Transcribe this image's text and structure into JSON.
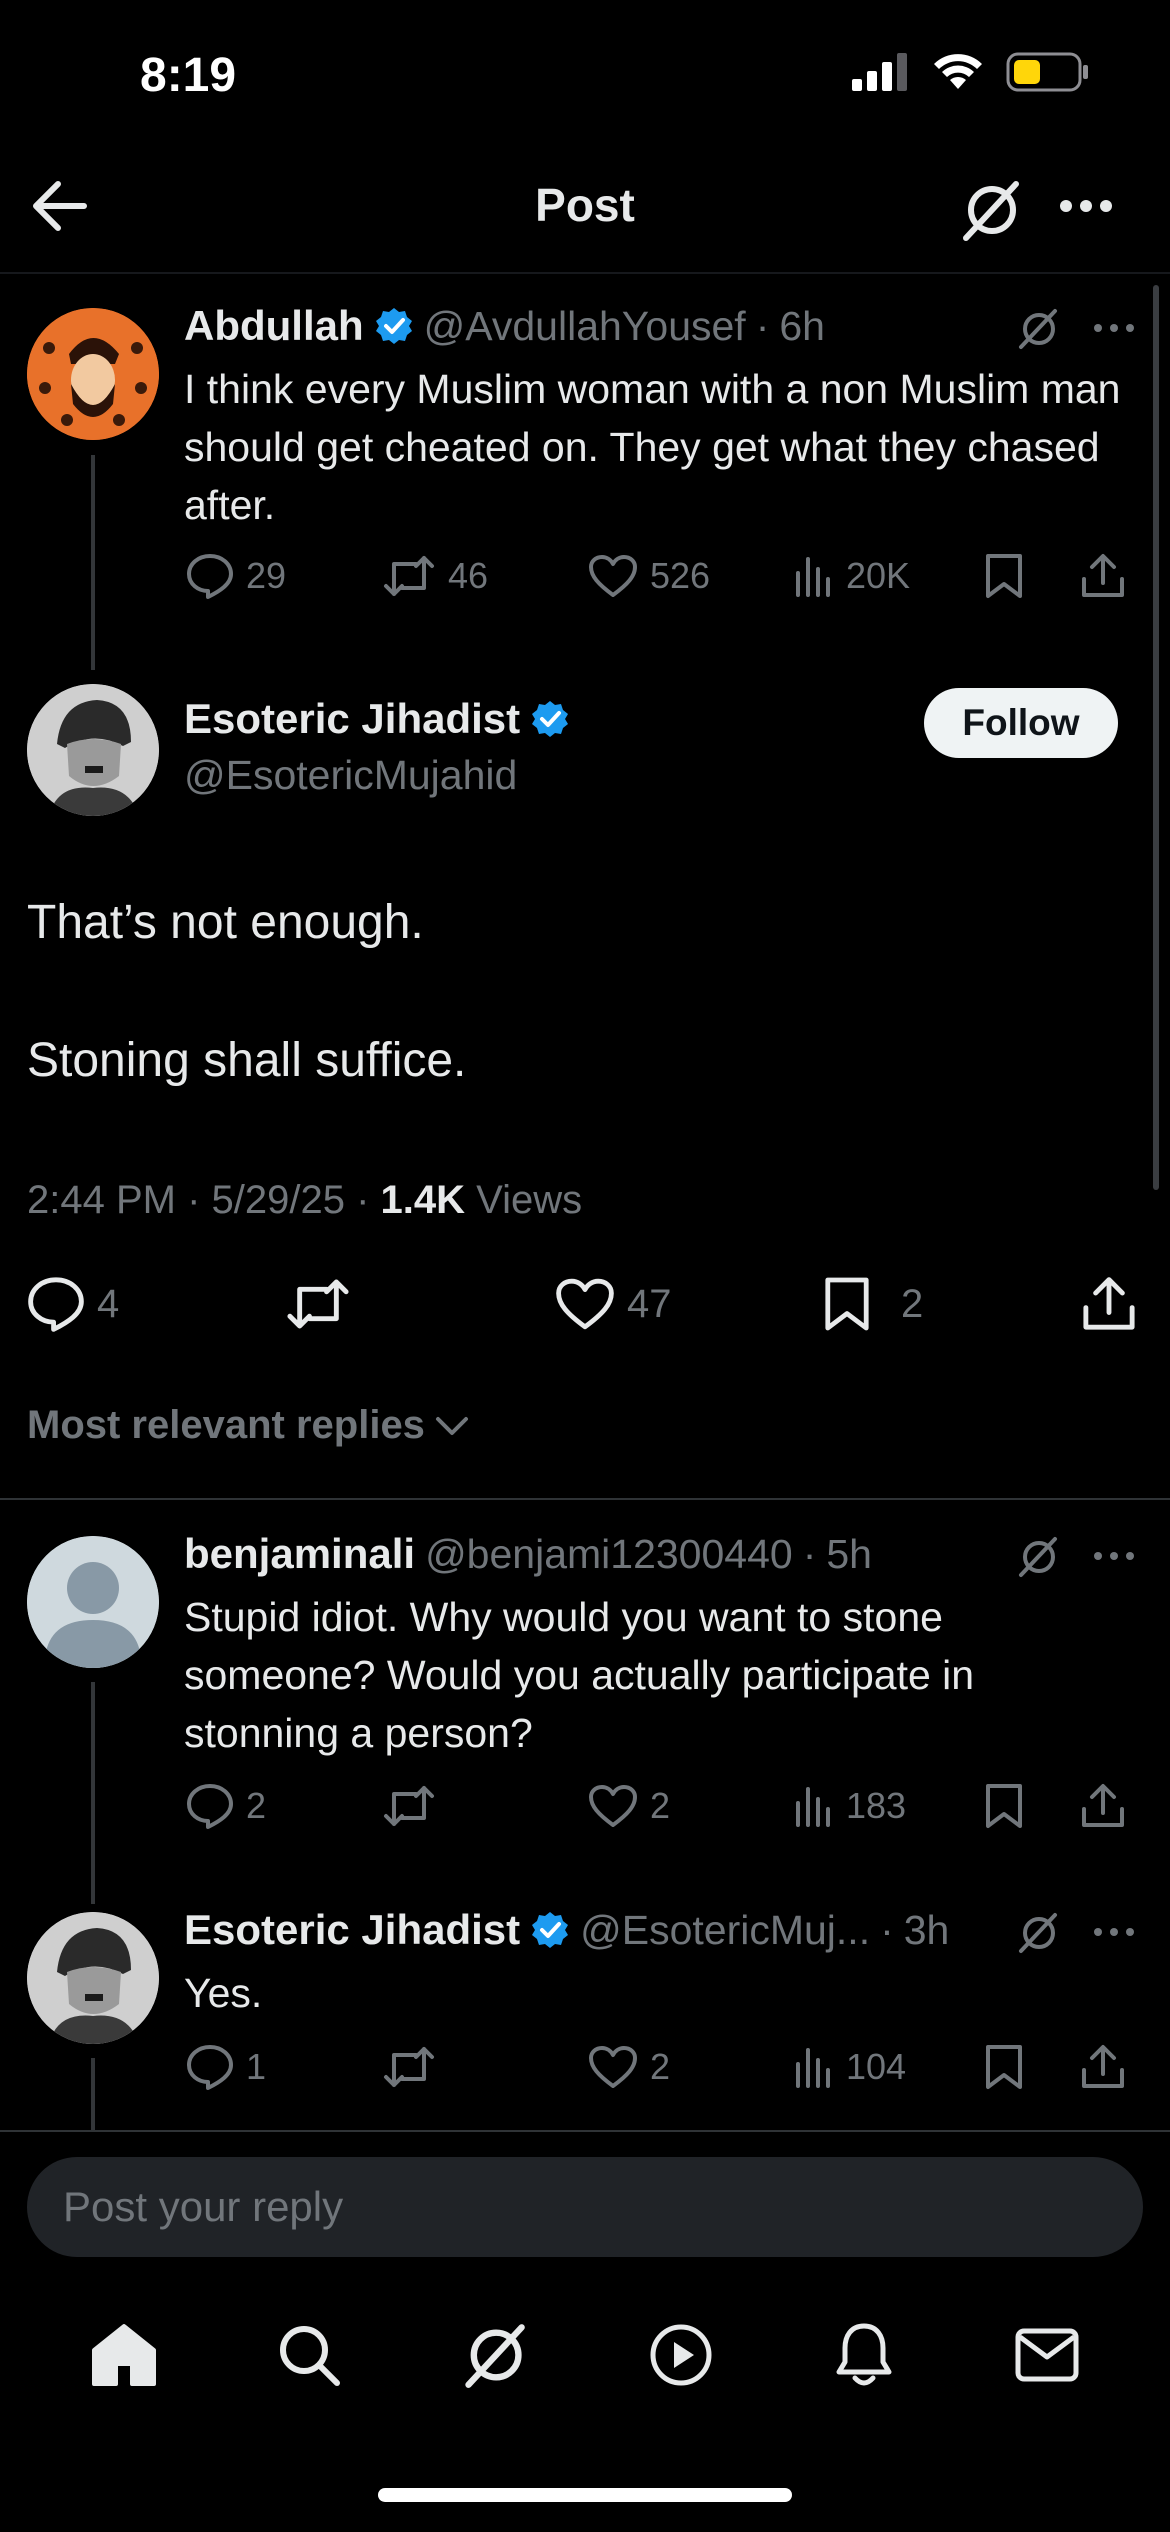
{
  "status": {
    "time": "8:19"
  },
  "header": {
    "title": "Post"
  },
  "parent_post": {
    "name": "Abdullah",
    "handle": "@AvdullahYousef",
    "time": "6h",
    "text": "I think every Muslim woman with a non Muslim man should get cheated on. They get what they chased after.",
    "replies": "29",
    "reposts": "46",
    "likes": "526",
    "views": "20K"
  },
  "main_post": {
    "name": "Esoteric Jihadist",
    "handle": "@EsotericMujahid",
    "follow_label": "Follow",
    "line1": "That’s not enough.",
    "line2": "Stoning shall suffice.",
    "date": "2:44 PM · 5/29/25 · ",
    "views_count": "1.4K",
    "views_label": "Views",
    "replies": "4",
    "likes": "47",
    "bookmarks": "2"
  },
  "sort": {
    "label": "Most relevant replies"
  },
  "reply1": {
    "name": "benjaminali",
    "handle": "@benjami12300440",
    "time": "5h",
    "text": "Stupid idiot. Why would you want to stone someone? Would you actually participate in stonning a person?",
    "replies": "2",
    "likes": "2",
    "views": "183"
  },
  "reply2": {
    "name": "Esoteric Jihadist",
    "handle": "@EsotericMuj...",
    "time": "3h",
    "text": "Yes.",
    "replies": "1",
    "likes": "2",
    "views": "104"
  },
  "composer": {
    "placeholder": "Post your reply"
  },
  "colors": {
    "verified": "#1d9bf0",
    "background": "#000000",
    "muted": "#71767b"
  },
  "tabs": [
    "home-icon",
    "search-icon",
    "grok-icon",
    "video-icon",
    "notifications-icon",
    "messages-icon"
  ]
}
